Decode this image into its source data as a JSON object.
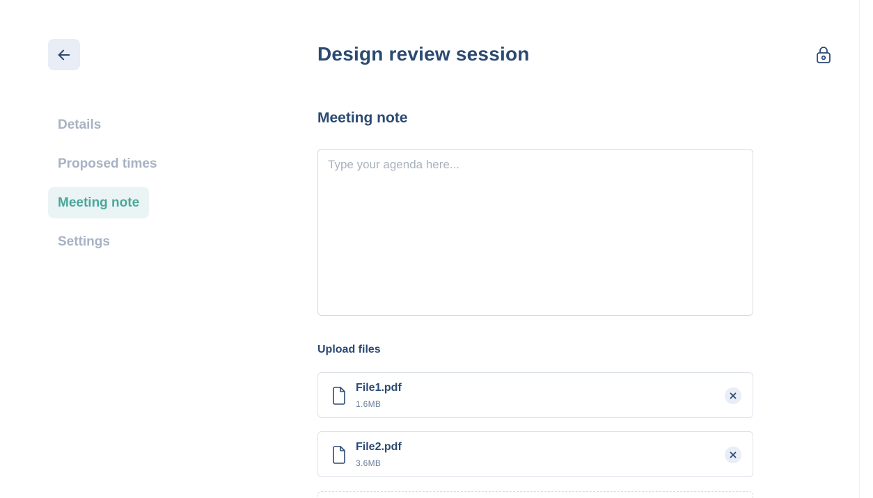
{
  "header": {
    "title": "Design review session",
    "back_icon": "arrow-left-icon",
    "lock_icon": "lock-icon"
  },
  "sidebar": {
    "items": [
      {
        "label": "Details",
        "active": false
      },
      {
        "label": "Proposed times",
        "active": false
      },
      {
        "label": "Meeting note",
        "active": true
      },
      {
        "label": "Settings",
        "active": false
      }
    ]
  },
  "main": {
    "section_title": "Meeting note",
    "note": {
      "placeholder": "Type your agenda here...",
      "value": ""
    },
    "upload": {
      "label": "Upload files",
      "files": [
        {
          "name": "File1.pdf",
          "size": "1.6MB"
        },
        {
          "name": "File2.pdf",
          "size": "3.6MB"
        }
      ]
    }
  },
  "colors": {
    "primary_text": "#2b4a72",
    "muted_text": "#a7b2c3",
    "accent": "#4aa79c",
    "accent_bg": "#ebf4f4",
    "button_bg": "#e8edf6",
    "border": "#d5dbe4"
  }
}
